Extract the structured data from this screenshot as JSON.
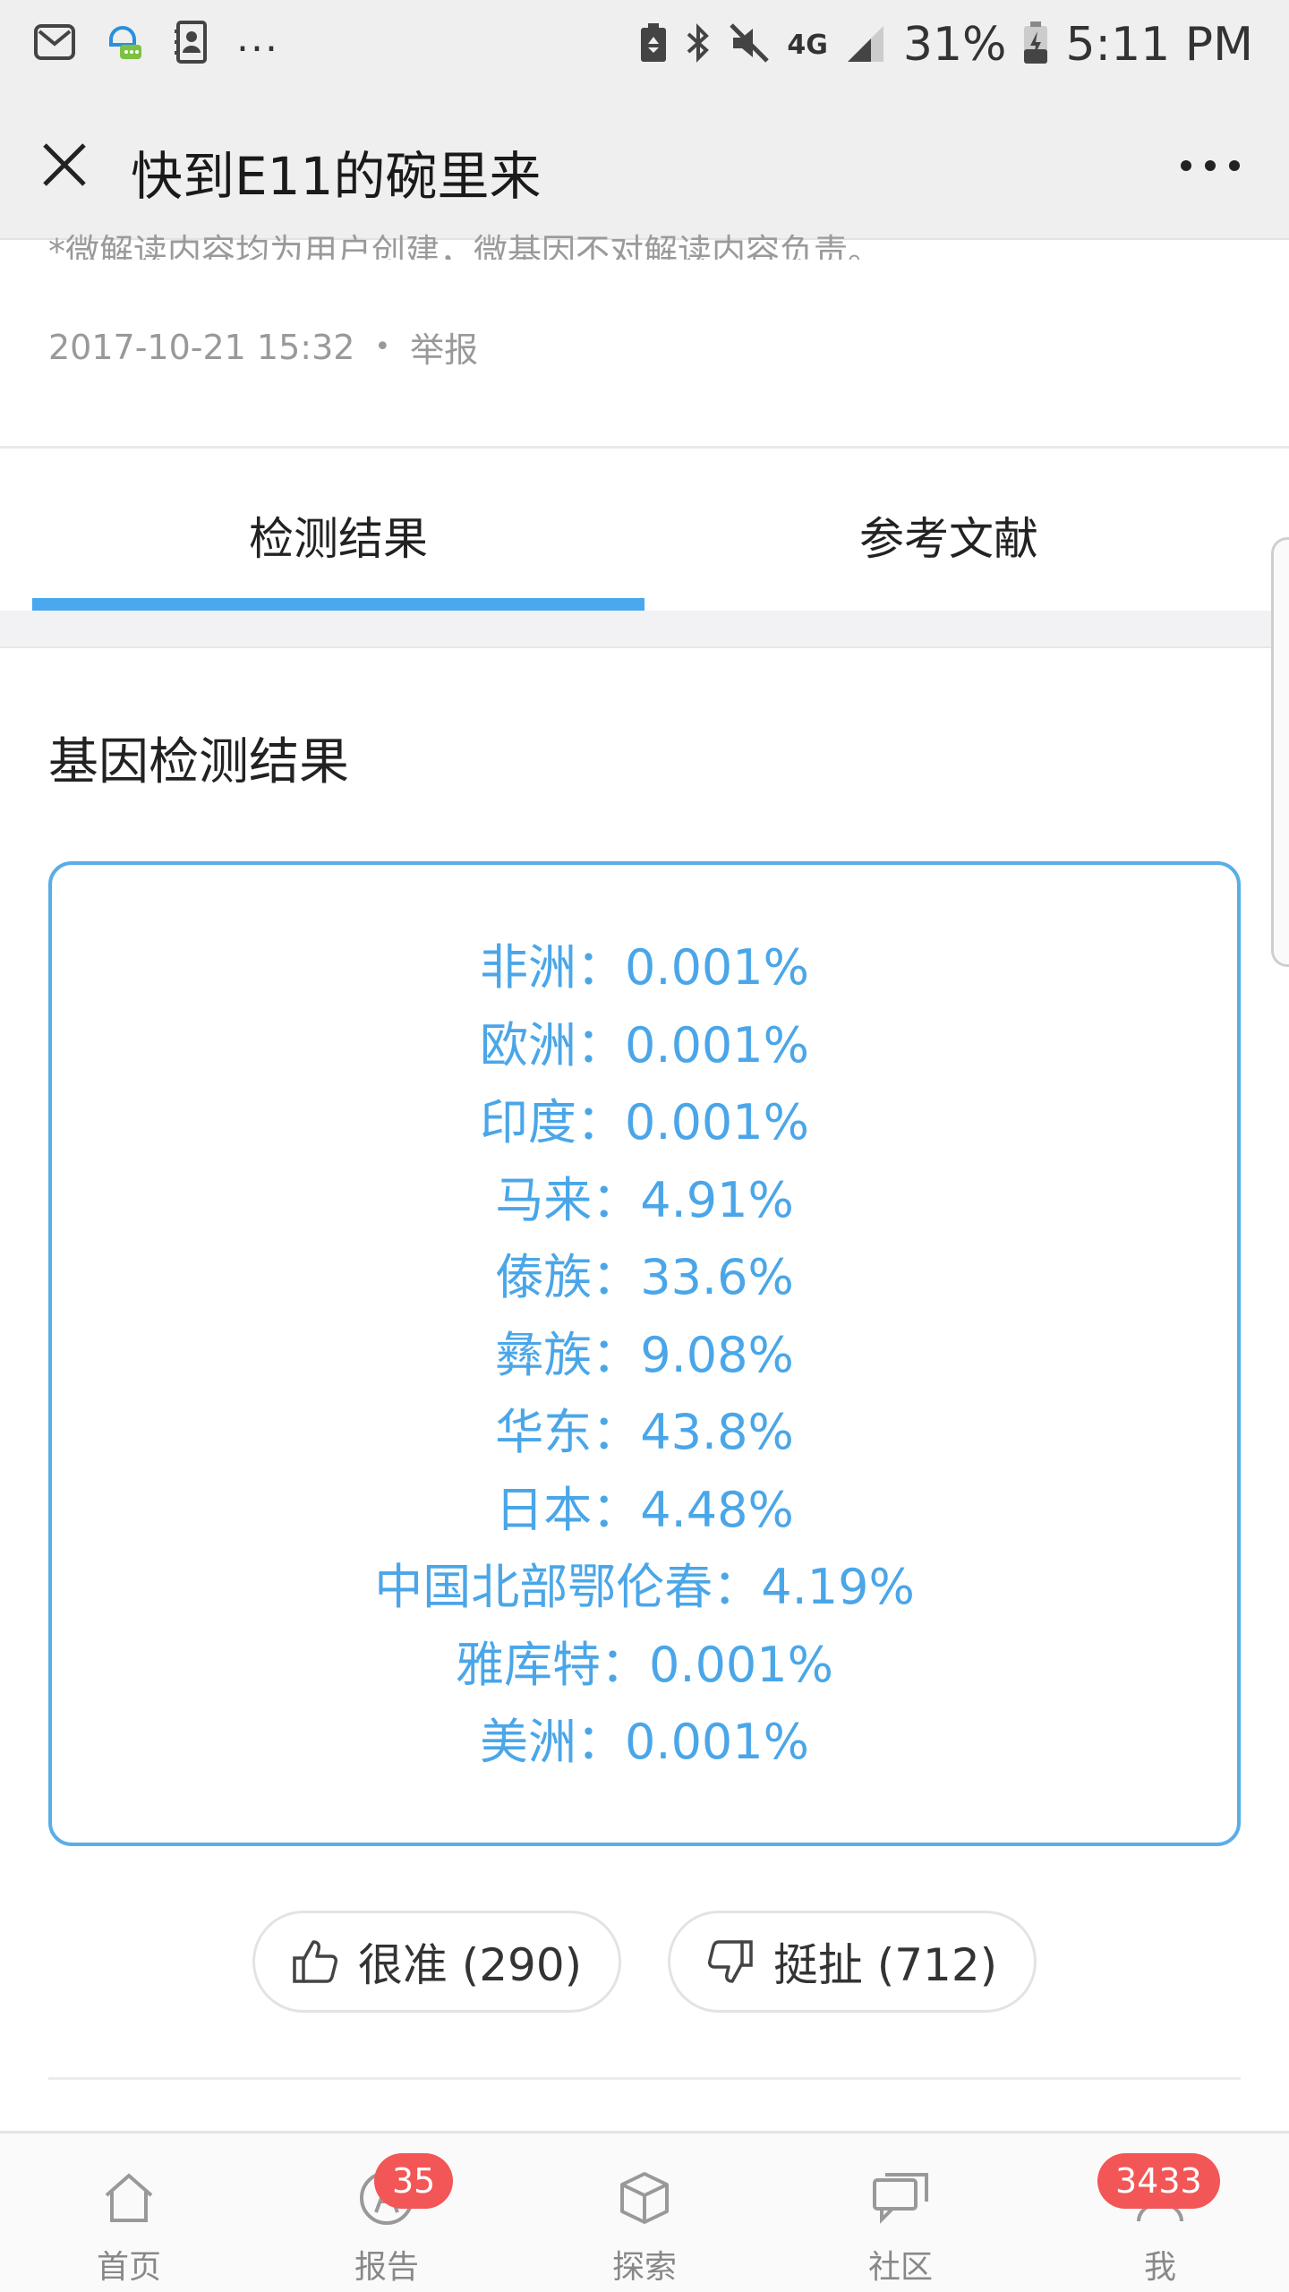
{
  "status_bar": {
    "more": "...",
    "network": "4G",
    "battery": "31%",
    "time": "5:11 PM"
  },
  "header": {
    "title": "快到E11的碗里来"
  },
  "post": {
    "disclaimer": "*微解读内容均为用户创建，微基因不对解读内容负责。",
    "date": "2017-10-21 15:32",
    "separator": "•",
    "report": "举报"
  },
  "tabs": [
    {
      "label": "检测结果",
      "active": true
    },
    {
      "label": "参考文献",
      "active": false
    }
  ],
  "section_title": "基因检测结果",
  "results": [
    {
      "name": "非洲：",
      "value": "0.001%"
    },
    {
      "name": "欧洲：",
      "value": "0.001%"
    },
    {
      "name": "印度：",
      "value": "0.001%"
    },
    {
      "name": "马来：",
      "value": "4.91%"
    },
    {
      "name": "傣族：",
      "value": "33.6%"
    },
    {
      "name": "彝族：",
      "value": "9.08%"
    },
    {
      "name": "华东：",
      "value": "43.8%"
    },
    {
      "name": "日本：",
      "value": "4.48%"
    },
    {
      "name": "中国北部鄂伦春：",
      "value": "4.19%"
    },
    {
      "name": "雅库特：",
      "value": "0.001%"
    },
    {
      "name": "美洲：",
      "value": "0.001%"
    }
  ],
  "votes": {
    "like_label": "很准 (290)",
    "dislike_label": "挺扯 (712)"
  },
  "tabbar": [
    {
      "label": "首页",
      "icon": "home-icon",
      "badge": ""
    },
    {
      "label": "报告",
      "icon": "report-icon",
      "badge": "35"
    },
    {
      "label": "探索",
      "icon": "cube-icon",
      "badge": ""
    },
    {
      "label": "社区",
      "icon": "chat-icon",
      "badge": ""
    },
    {
      "label": "我",
      "icon": "profile-icon",
      "badge": "3433"
    }
  ],
  "colors": {
    "accent": "#49a8ee",
    "result_text": "#4aa6e8",
    "badge": "#f35656"
  }
}
